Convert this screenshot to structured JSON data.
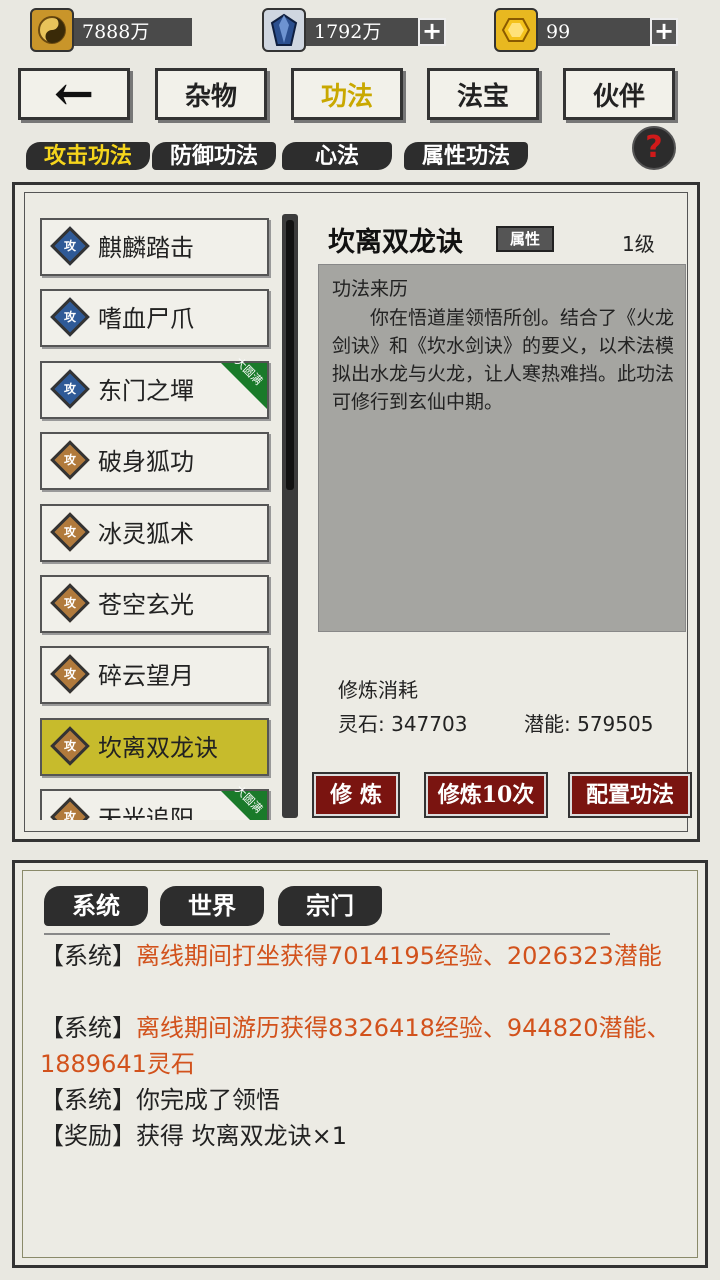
{
  "resources": [
    {
      "icon": "yin-yang-coin-icon",
      "value": "7888万"
    },
    {
      "icon": "blue-crystal-icon",
      "value": "1792万"
    },
    {
      "icon": "gold-gem-icon",
      "value": "99"
    }
  ],
  "plus_glyph": "+",
  "nav": {
    "back_glyph": "←",
    "tabs": [
      {
        "label": "杂物"
      },
      {
        "label": "功法"
      },
      {
        "label": "法宝"
      },
      {
        "label": "伙伴"
      }
    ]
  },
  "categories": [
    "攻击功法",
    "防御功法",
    "心法",
    "属性功法"
  ],
  "help_glyph": "?",
  "skills": [
    {
      "name": "麒麟踏击",
      "emblem": "攻"
    },
    {
      "name": "嗜血尸爪",
      "emblem": "攻"
    },
    {
      "name": "东门之墠",
      "emblem": "攻",
      "badge": "大圆满"
    },
    {
      "name": "破身狐功",
      "emblem": "攻"
    },
    {
      "name": "冰灵狐术",
      "emblem": "攻"
    },
    {
      "name": "苍空玄光",
      "emblem": "攻"
    },
    {
      "name": "碎云望月",
      "emblem": "攻"
    },
    {
      "name": "坎离双龙诀",
      "emblem": "攻"
    },
    {
      "name": "天光追阳",
      "emblem": "攻",
      "badge": "大圆满"
    }
  ],
  "detail": {
    "title": "坎离双龙诀",
    "tag": "属性",
    "level": "1级",
    "source_header": "功法来历",
    "description": "你在悟道崖领悟所创。结合了《火龙剑诀》和《坎水剑诀》的要义，以术法模拟出水龙与火龙，让人寒热难挡。此功法可修行到玄仙中期。",
    "cost_header": "修炼消耗",
    "spirit_stone": "灵石: 347703",
    "potential": "潜能: 579505"
  },
  "actions": [
    "修 炼",
    "修炼10次",
    "配置功法"
  ],
  "chat": {
    "tabs": [
      "系统",
      "世界",
      "宗门"
    ],
    "messages": [
      {
        "prefix": "【系统】",
        "text": "离线期间打坐获得7014195经验、2026323潜能",
        "highlight": true
      },
      {
        "prefix": "【系统】",
        "text": "离线期间游历获得8326418经验、944820潜能、1889641灵石",
        "highlight": true
      },
      {
        "prefix": "【系统】",
        "text": "你完成了领悟",
        "highlight": false
      },
      {
        "prefix": "【奖励】",
        "text": "获得 坎离双龙诀×1",
        "highlight": false
      }
    ]
  }
}
